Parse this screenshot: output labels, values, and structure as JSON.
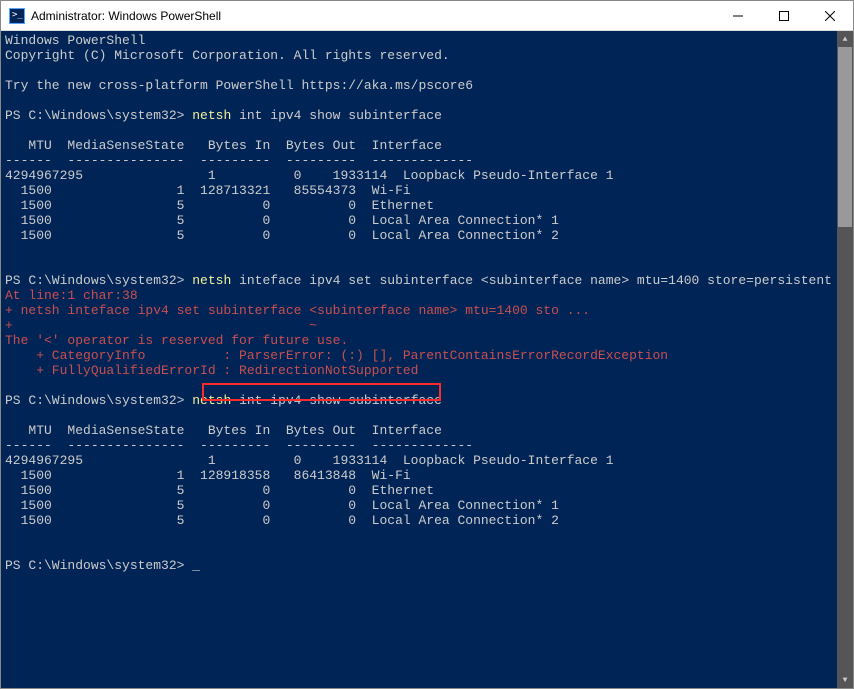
{
  "title": "Administrator: Windows PowerShell",
  "banner_line1": "Windows PowerShell",
  "banner_line2": "Copyright (C) Microsoft Corporation. All rights reserved.",
  "banner_line3": "Try the new cross-platform PowerShell https://aka.ms/pscore6",
  "prompt": "PS C:\\Windows\\system32>",
  "cmd1_a": "netsh",
  "cmd1_b": " int ipv4 show subinterface",
  "table_header": "   MTU  MediaSenseState   Bytes In  Bytes Out  Interface",
  "table_divider": "------  ---------------  ---------  ---------  -------------",
  "t1_rows": [
    "4294967295                1          0    1933114  Loopback Pseudo-Interface 1",
    "  1500                1  128713321   85554373  Wi-Fi",
    "  1500                5          0          0  Ethernet",
    "  1500                5          0          0  Local Area Connection* 1",
    "  1500                5          0          0  Local Area Connection* 2"
  ],
  "cmd2_a": "netsh",
  "cmd2_b": " inteface ipv4 set subinterface <subinterface name> mtu=1400 store=persistent",
  "err1": "At line:1 char:38",
  "err2": "+ netsh inteface ipv4 set subinterface <subinterface name> mtu=1400 sto ...",
  "err3": "+                                      ~",
  "err4": "The '<' operator is reserved for future use.",
  "err5": "    + CategoryInfo          : ParserError: (:) [], ParentContainsErrorRecordException",
  "err6": "    + FullyQualifiedErrorId : RedirectionNotSupported",
  "cmd3_a": "netsh",
  "cmd3_b": " int ipv4 show subinterface",
  "t2_rows": [
    "4294967295                1          0    1933114  Loopback Pseudo-Interface 1",
    "  1500                1  128918358   86413848  Wi-Fi",
    "  1500                5          0          0  Ethernet",
    "  1500                5          0          0  Local Area Connection* 1",
    "  1500                5          0          0  Local Area Connection* 2"
  ],
  "cursor": "_"
}
